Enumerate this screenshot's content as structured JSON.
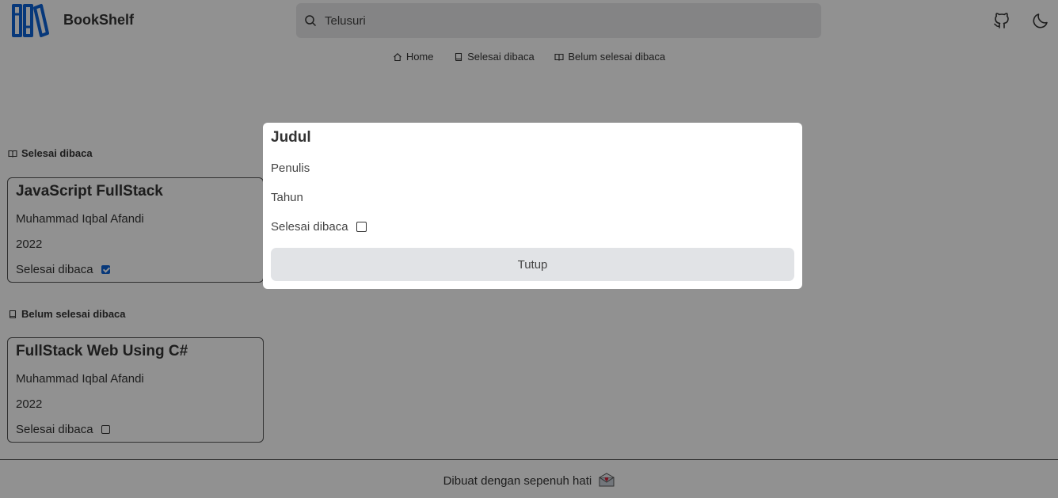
{
  "header": {
    "brand": "BookShelf",
    "search_placeholder": "Telusuri"
  },
  "icons": {
    "logo": "books-logo-icon",
    "github": "github-icon",
    "theme": "moon-icon",
    "brand_color": "#0d63d6"
  },
  "nav": {
    "items": [
      {
        "label": "Home",
        "icon": "home-icon"
      },
      {
        "label": "Selesai dibaca",
        "icon": "book-icon"
      },
      {
        "label": "Belum selesai dibaca",
        "icon": "book-open-icon"
      }
    ]
  },
  "sections": [
    {
      "title": "Selesai dibaca",
      "icon": "book-open-icon",
      "books": [
        {
          "title": "JavaScript FullStack",
          "author": "Muhammad Iqbal Afandi",
          "year": "2022",
          "done_label": "Selesai dibaca",
          "done": true
        }
      ]
    },
    {
      "title": "Belum selesai dibaca",
      "icon": "book-icon",
      "books": [
        {
          "title": "FullStack Web Using C#",
          "author": "Muhammad Iqbal Afandi",
          "year": "2022",
          "done_label": "Selesai dibaca",
          "done": false
        }
      ]
    }
  ],
  "footer": {
    "text": "Dibuat dengan sepenuh hati"
  },
  "modal": {
    "title": "Judul",
    "author_label": "Penulis",
    "year_label": "Tahun",
    "done_label": "Selesai dibaca",
    "done": false,
    "close_label": "Tutup"
  }
}
